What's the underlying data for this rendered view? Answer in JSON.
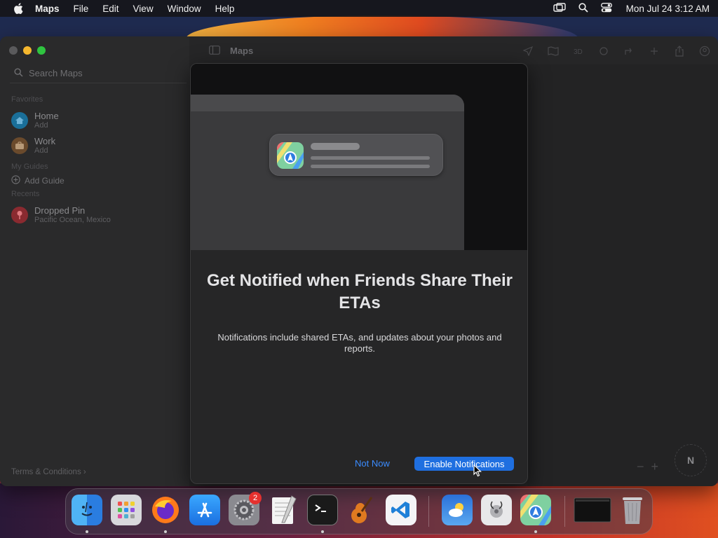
{
  "menubar": {
    "app_name": "Maps",
    "items": [
      "File",
      "Edit",
      "View",
      "Window",
      "Help"
    ],
    "clock": "Mon Jul 24  3:12 AM"
  },
  "window": {
    "title": "Maps",
    "search_placeholder": "Search Maps",
    "favorites_label": "Favorites",
    "favorites": [
      {
        "title": "Home",
        "subtitle": "Add",
        "color": "#1a8fc9"
      },
      {
        "title": "Work",
        "subtitle": "Add",
        "color": "#8a5a2c"
      }
    ],
    "guides_label": "My Guides",
    "add_guide": "Add Guide",
    "recents_label": "Recents",
    "recents": [
      {
        "title": "Dropped Pin",
        "subtitle": "Pacific Ocean, Mexico",
        "color": "#c0323a"
      }
    ],
    "terms": "Terms & Conditions",
    "compass": "N"
  },
  "modal": {
    "title": "Get Notified when Friends Share Their ETAs",
    "body": "Notifications include shared ETAs, and updates about your photos and reports.",
    "not_now": "Not Now",
    "enable": "Enable Notifications"
  },
  "dock": {
    "badge_count": "2",
    "apps": [
      "finder-icon",
      "launchpad-icon",
      "firefox-icon",
      "app-store-icon",
      "system-settings-icon",
      "textedit-icon",
      "terminal-icon",
      "garageband-icon",
      "vscode-icon",
      "weather-icon",
      "disk-utility-icon",
      "maps-icon",
      "window-thumbnail-icon",
      "trash-icon"
    ]
  },
  "colors": {
    "accent": "#1f6fe0",
    "link": "#3b8cff"
  }
}
